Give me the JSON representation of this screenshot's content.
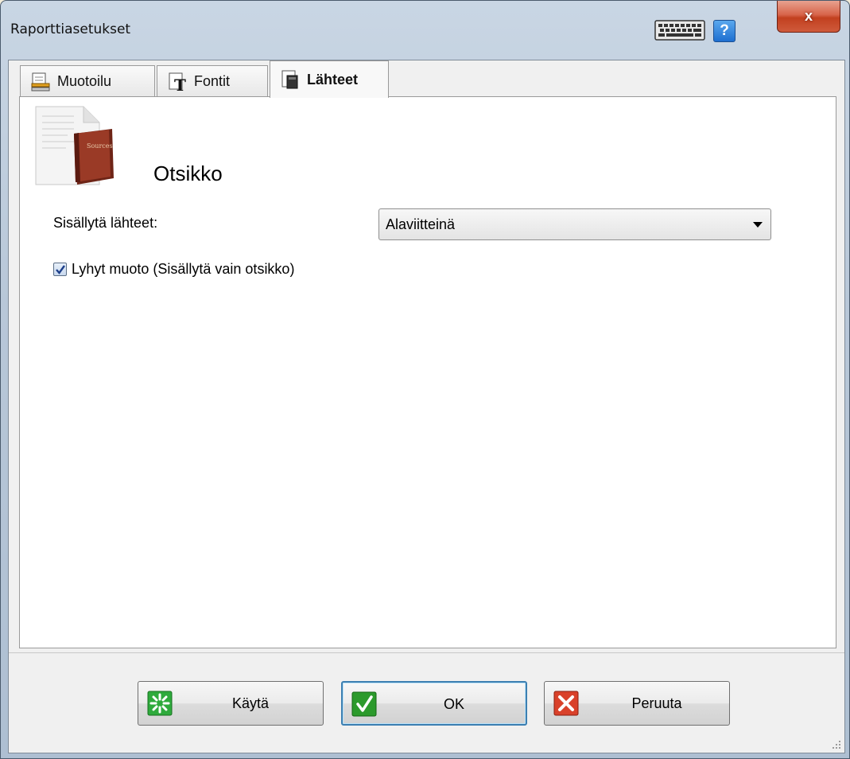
{
  "window": {
    "title": "Raporttiasetukset",
    "close_label": "x",
    "help_label": "?"
  },
  "tabs": [
    {
      "label": "Muotoilu",
      "icon": "format-icon",
      "active": false
    },
    {
      "label": "Fontit",
      "icon": "font-icon",
      "active": false
    },
    {
      "label": "Lähteet",
      "icon": "sources-icon",
      "active": true
    }
  ],
  "panel": {
    "heading": "Otsikko",
    "book_cover_text": "Sources",
    "include_sources_label": "Sisällytä lähteet:",
    "include_sources_value": "Alaviitteinä",
    "short_form_label": "Lyhyt muoto (Sisällytä vain otsikko)",
    "short_form_checked": true
  },
  "buttons": {
    "apply": "Käytä",
    "ok": "OK",
    "cancel": "Peruuta"
  },
  "colors": {
    "apply_icon": "#2eaa3c",
    "ok_icon": "#2c9a2c",
    "cancel_icon": "#d9412a",
    "book": "#8b2e1e"
  }
}
